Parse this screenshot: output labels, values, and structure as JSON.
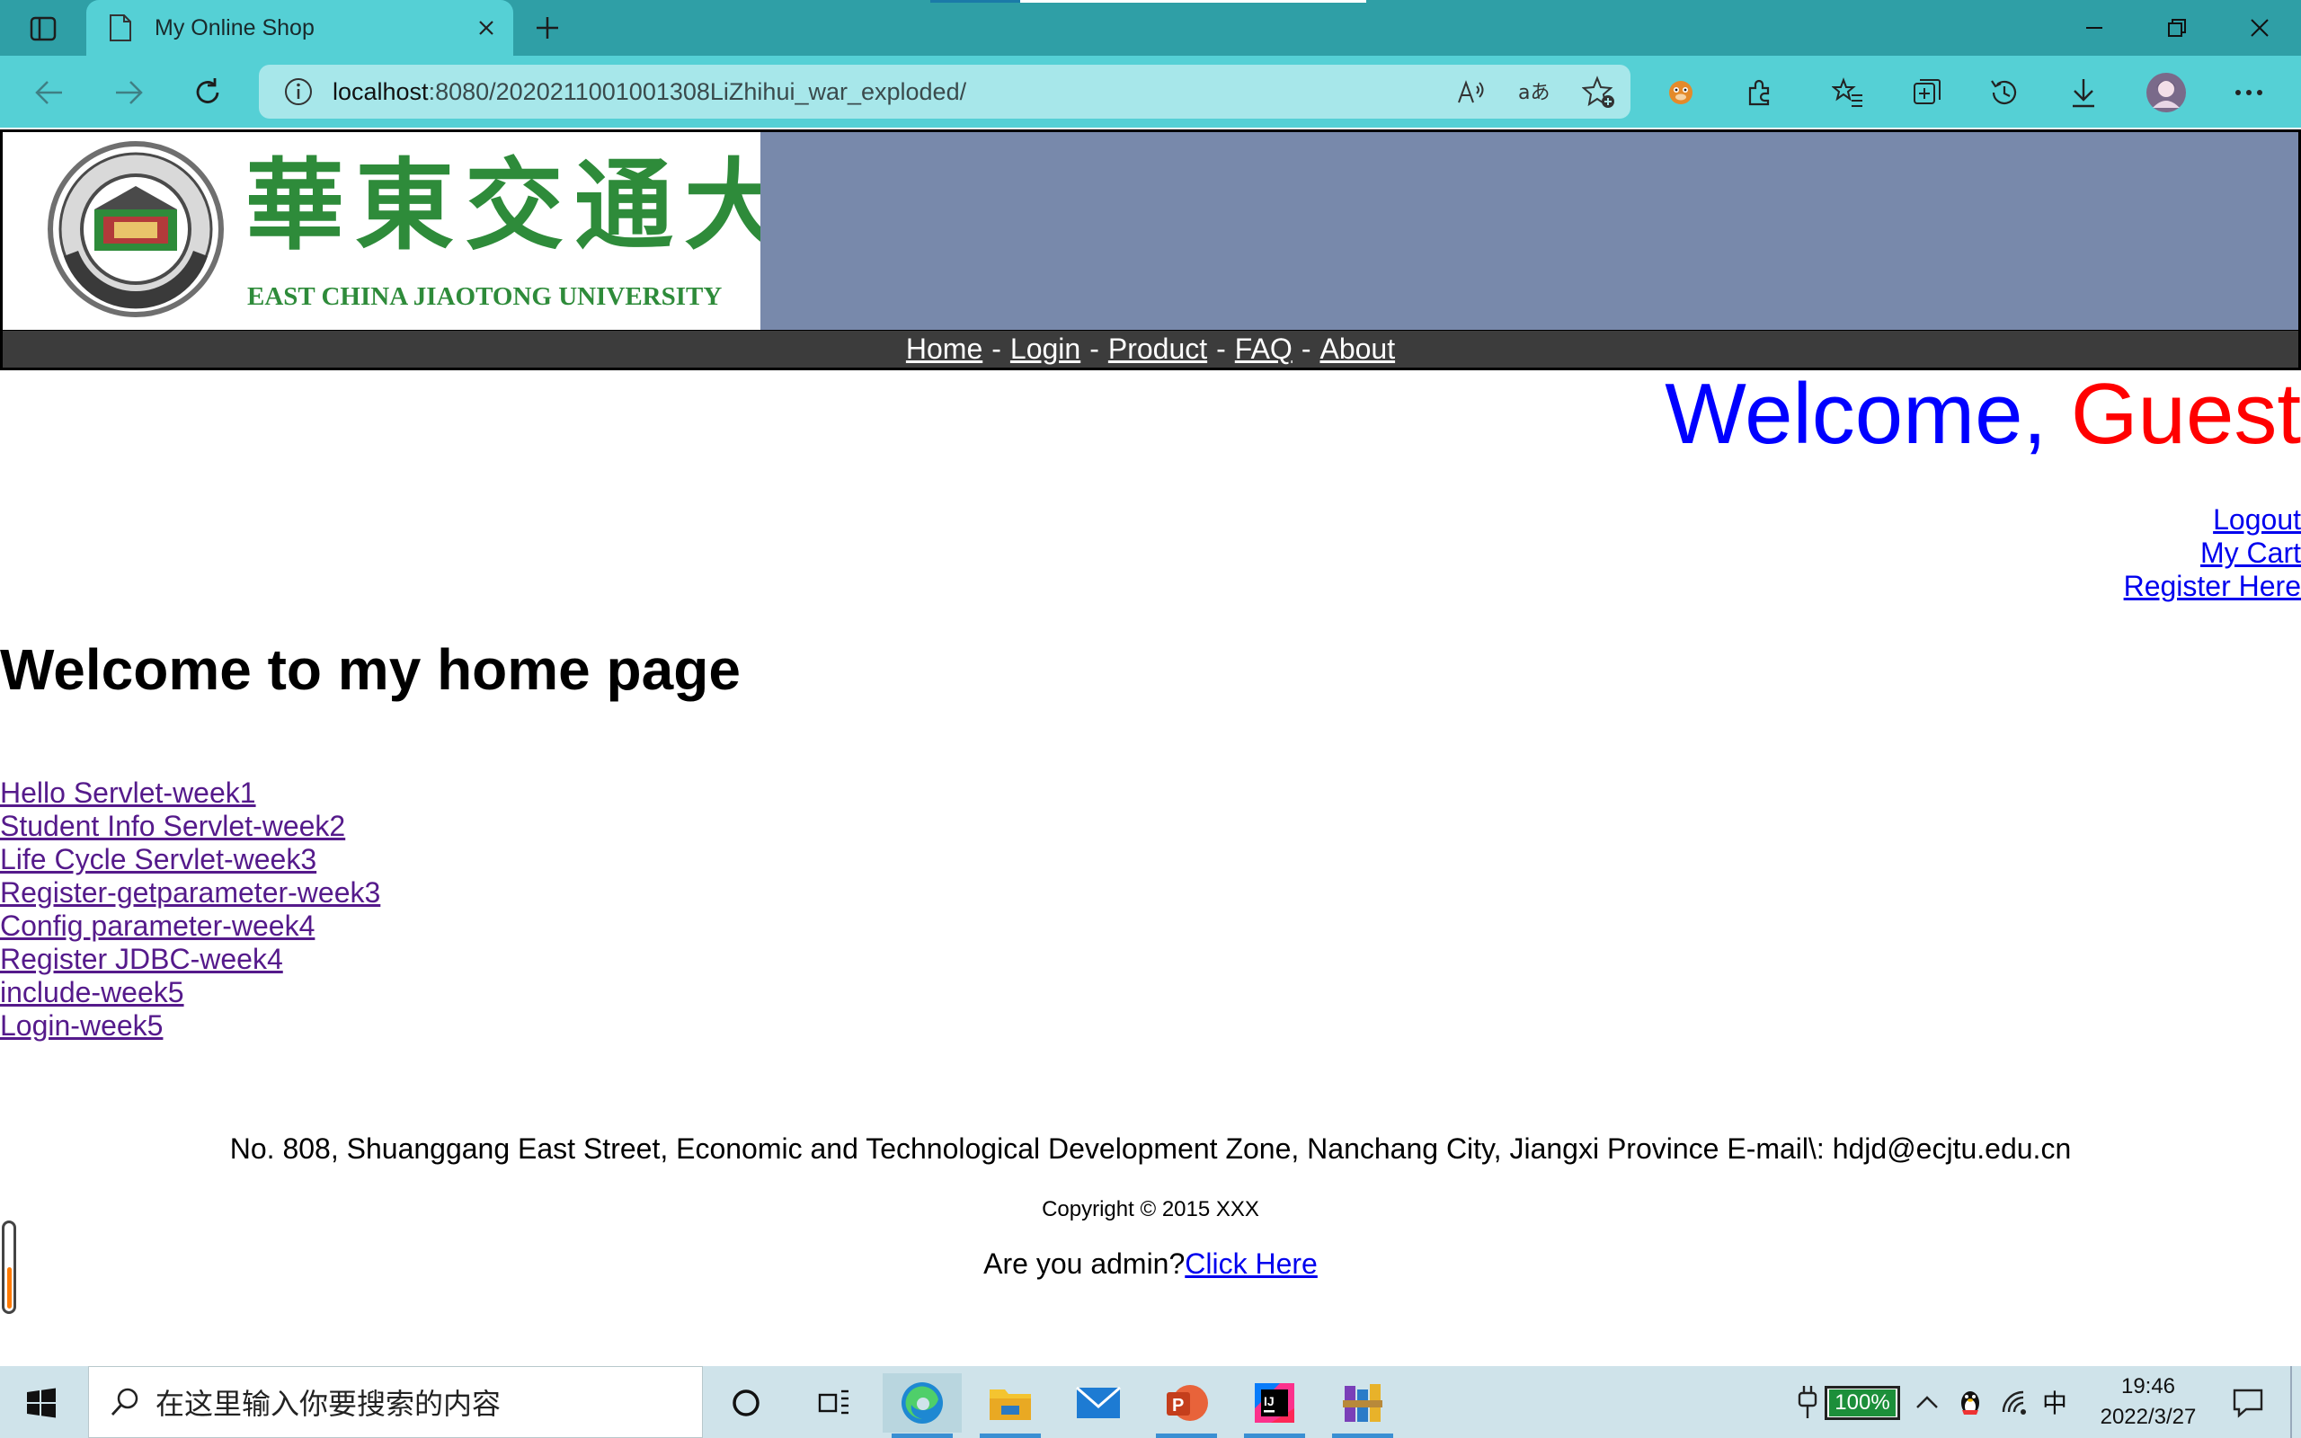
{
  "browser": {
    "tab_title": "My Online Shop",
    "url_host": "localhost",
    "url_path": ":8080/2020211001001308LiZhihui_war_exploded/"
  },
  "site": {
    "logo_text": "EAST CHINA JIAOTONG UNIVERSITY",
    "logo_chinese": "華東交通大學",
    "nav": [
      {
        "label": "Home"
      },
      {
        "label": "Login"
      },
      {
        "label": "Product"
      },
      {
        "label": "FAQ"
      },
      {
        "label": "About"
      }
    ],
    "nav_separator": "-",
    "welcome_word": "Welcome,",
    "welcome_user": "Guest",
    "user_links": {
      "logout": "Logout",
      "cart": "My Cart",
      "register": "Register Here"
    }
  },
  "main": {
    "heading": "Welcome to my home page",
    "links": [
      {
        "label": "Hello Servlet-week1"
      },
      {
        "label": "Student Info Servlet-week2"
      },
      {
        "label": "Life Cycle Servlet-week3"
      },
      {
        "label": "Register-getparameter-week3"
      },
      {
        "label": "Config parameter-week4"
      },
      {
        "label": "Register JDBC-week4"
      },
      {
        "label": "include-week5"
      },
      {
        "label": "Login-week5"
      }
    ]
  },
  "footer": {
    "address": "No. 808, Shuanggang East Street, Economic and Technological Development Zone, Nanchang City, Jiangxi Province E-mail\\: hdjd@ecjtu.edu.cn",
    "copyright": "Copyright © 2015 XXX",
    "admin_prompt": "Are you admin?",
    "admin_link": "Click Here"
  },
  "taskbar": {
    "search_placeholder": "在这里输入你要搜索的内容",
    "battery": "100%",
    "ime": "中",
    "time": "19:46",
    "date": "2022/3/27"
  },
  "colors": {
    "titlebar": "#2f9fa6",
    "toolbar": "#55d0d5",
    "banner": "#7889ab",
    "navbar": "#3c3c3c",
    "welcome": "#0000ff",
    "guest": "#ff0000",
    "link": "#0000ee",
    "visited_link": "#551a8b",
    "logo_green": "#2e8b3a"
  }
}
